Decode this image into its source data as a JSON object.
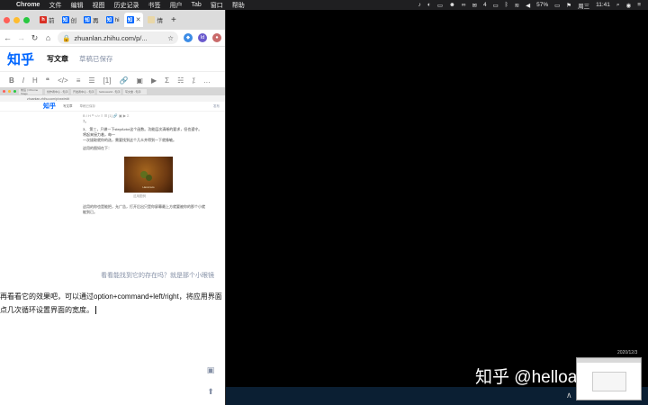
{
  "menubar": {
    "apple": "",
    "app": "Chrome",
    "items": [
      "文件",
      "编辑",
      "视图",
      "历史记录",
      "书签",
      "用户",
      "Tab",
      "窗口",
      "帮助"
    ],
    "wechat_count": "4",
    "battery": "57%",
    "day": "周三",
    "time": "11:41"
  },
  "browser": {
    "tabs": [
      {
        "icon": "h",
        "label": "前",
        "color": "#d93025"
      },
      {
        "icon": "知",
        "label": "创",
        "color": "#0066ff"
      },
      {
        "icon": "知",
        "label": "再",
        "color": "#0066ff"
      },
      {
        "icon": "知",
        "label": "hi",
        "color": "#0066ff"
      },
      {
        "icon": "知",
        "label": "",
        "color": "#0066ff"
      },
      {
        "icon": "",
        "label": "情",
        "color": "#e9d7a8"
      }
    ],
    "new_tab": "+",
    "url": "zhuanlan.zhihu.com/p/...",
    "ext_label": "ld"
  },
  "zhihu": {
    "logo": "知乎",
    "write": "写文章",
    "draft_status": "草稿已保存"
  },
  "editor_tools": [
    "B",
    "I",
    "H",
    "❝",
    "</>",
    "≡",
    "☰",
    "[1]",
    "🔗",
    "▣",
    "▶",
    "Σ",
    "☵",
    "⁒",
    "…"
  ],
  "screenshot": {
    "tab_labels": [
      "前后 | Chrome Stage",
      "创作者中心 - 知乎",
      "开发者中心 - 知乎",
      "hellosworld - 知乎",
      "写文章 - 知乎"
    ],
    "url": "zhuanlan.zhihu.com/p/xxx/edit",
    "logo": "知乎",
    "write": "写文章",
    "draft": "草稿已保存",
    "publish": "发布",
    "lines": [
      "7。",
      "3、 第三，只做一下stepActor这个函数。功能层次清晰的要求，但也遵守。将起来接力着，每一",
      "一次拔取就你的选，需要找到这个几众并得到一下就像敏。",
      "这用的图如在下："
    ],
    "image_caption": "Hazelnuts",
    "figure_caption": "这用图例",
    "footer_line": "这用的你也是能把，允广告，打开后出只是你屏幕最上方就要被你的那个小就能到已。"
  },
  "content": {
    "caption": "看看能找到它的存在吗？就是那个小眼镜",
    "line1": "再看看它的效果吧，可以通过option+command+left/right，将应用界面",
    "line2": "点几次循环设置界面的宽度。"
  },
  "desktop": {
    "watermark": "知乎 @helloadolf",
    "thumb_label": "2020/12/3"
  }
}
